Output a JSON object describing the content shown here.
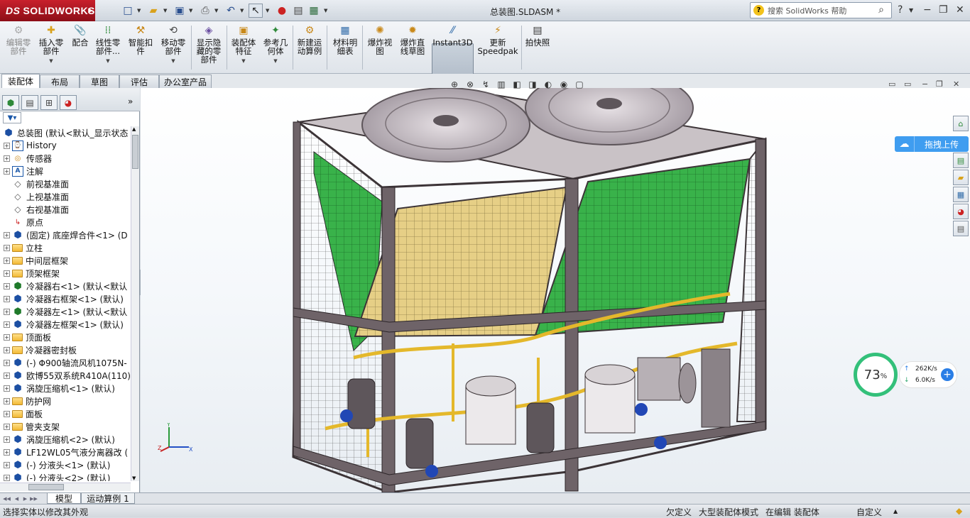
{
  "app": {
    "logo": "SOLIDWORKS",
    "doc_title": "总装图.SLDASM *"
  },
  "help": {
    "search_placeholder": "搜索 SolidWorks 帮助"
  },
  "commands": [
    {
      "label": "编辑零\n部件",
      "disabled": true,
      "icon": "edit-component-icon"
    },
    {
      "label": "插入零\n部件",
      "icon": "insert-component-icon"
    },
    {
      "label": "配合",
      "icon": "mate-icon"
    },
    {
      "label": "线性零\n部件...",
      "icon": "linear-pattern-icon"
    },
    {
      "label": "智能扣\n件",
      "icon": "smart-fastener-icon"
    },
    {
      "label": "移动零\n部件",
      "icon": "move-component-icon"
    },
    {
      "label": "显示隐\n藏的零\n部件",
      "icon": "show-hidden-icon"
    },
    {
      "label": "装配体\n特征",
      "icon": "assembly-feature-icon"
    },
    {
      "label": "参考几\n何体",
      "icon": "reference-geometry-icon"
    },
    {
      "label": "新建运\n动算例",
      "icon": "motion-study-icon"
    },
    {
      "label": "材料明\n细表",
      "icon": "bom-icon"
    },
    {
      "label": "爆炸视\n图",
      "icon": "exploded-view-icon"
    },
    {
      "label": "爆炸直\n线草图",
      "icon": "explode-line-icon"
    },
    {
      "label": "Instant3D",
      "icon": "instant3d-icon"
    },
    {
      "label": "更新\nSpeedpak",
      "icon": "speedpak-icon"
    },
    {
      "label": "拍快照",
      "icon": "snapshot-icon"
    }
  ],
  "tabs": [
    "装配体",
    "布局",
    "草图",
    "评估",
    "办公室产品"
  ],
  "tree": {
    "root": "总装图  (默认<默认_显示状态",
    "items": [
      {
        "label": "History",
        "icon": "history-icon"
      },
      {
        "label": "传感器",
        "icon": "sensor-icon"
      },
      {
        "label": "注解",
        "icon": "annotation-icon"
      },
      {
        "label": "前视基准面",
        "icon": "plane-icon"
      },
      {
        "label": "上视基准面",
        "icon": "plane-icon"
      },
      {
        "label": "右视基准面",
        "icon": "plane-icon"
      },
      {
        "label": "原点",
        "icon": "origin-icon"
      },
      {
        "label": "(固定) 底座焊合件<1> (D",
        "icon": "subassembly-icon"
      },
      {
        "label": "立柱",
        "icon": "folder-icon"
      },
      {
        "label": "中间层框架",
        "icon": "folder-icon"
      },
      {
        "label": "顶架框架",
        "icon": "folder-icon"
      },
      {
        "label": "冷凝器右<1> (默认<默认",
        "icon": "part-icon"
      },
      {
        "label": "冷凝器右框架<1> (默认)",
        "icon": "subassembly-icon"
      },
      {
        "label": "冷凝器左<1> (默认<默认",
        "icon": "part-icon"
      },
      {
        "label": "冷凝器左框架<1> (默认)",
        "icon": "subassembly-icon"
      },
      {
        "label": "顶面板",
        "icon": "folder-icon"
      },
      {
        "label": "冷凝器密封板",
        "icon": "folder-icon"
      },
      {
        "label": "(-) Φ900轴流风机1075N-",
        "icon": "subassembly-icon"
      },
      {
        "label": "欧博55双系统R410A(110)",
        "icon": "subassembly-icon"
      },
      {
        "label": "涡旋压缩机<1> (默认)",
        "icon": "subassembly-icon"
      },
      {
        "label": "防护网",
        "icon": "folder-icon"
      },
      {
        "label": "面板",
        "icon": "folder-icon"
      },
      {
        "label": "管夹支架",
        "icon": "folder-icon"
      },
      {
        "label": "涡旋压缩机<2> (默认)",
        "icon": "subassembly-icon"
      },
      {
        "label": "LF12WL05气液分离器改 (",
        "icon": "subassembly-icon"
      },
      {
        "label": "(-) 分液头<1> (默认)",
        "icon": "subassembly-icon"
      },
      {
        "label": "(-) 分液头<2> (默认)",
        "icon": "subassembly-icon"
      }
    ]
  },
  "upload_label": "拖拽上传",
  "network": {
    "percent": "73",
    "percent_sign": "%",
    "up": "262K/s",
    "down": "6.0K/s"
  },
  "bottom_tabs": [
    "模型",
    "运动算例 1"
  ],
  "status": {
    "hint": "选择实体以修改其外观",
    "underdefined": "欠定义",
    "large_mode": "大型装配体模式",
    "editing": "在编辑 装配体",
    "custom": "自定义"
  }
}
